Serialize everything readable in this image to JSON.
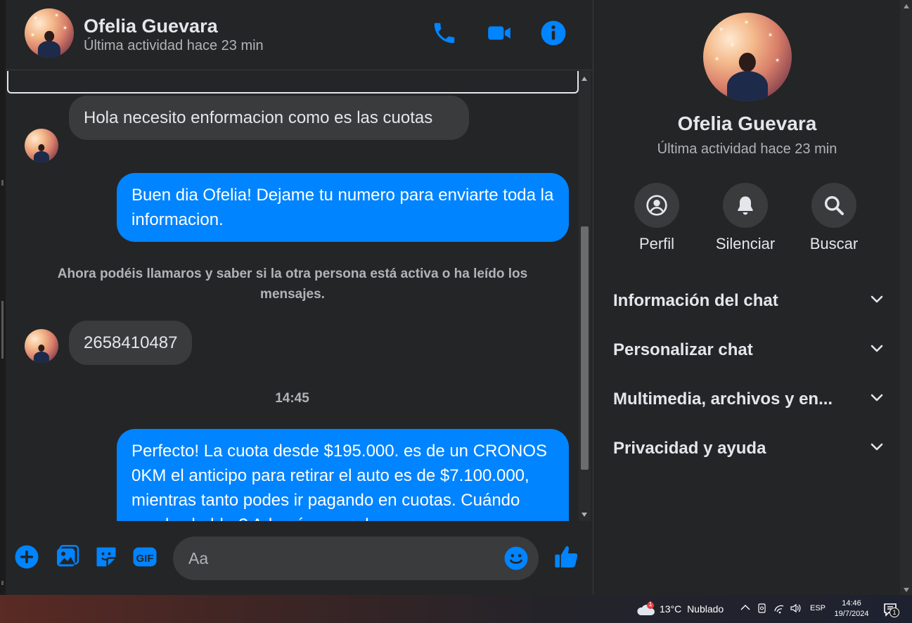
{
  "header": {
    "name": "Ofelia Guevara",
    "status": "Última actividad hace 23 min",
    "icons": [
      "phone-icon",
      "video-camera-icon",
      "info-icon"
    ]
  },
  "messages": [
    {
      "direction": "in",
      "text": "Hola necesito enformacion como es las cuotas"
    },
    {
      "direction": "out",
      "text": "Buen dia Ofelia! Dejame tu numero para enviarte toda la informacion."
    },
    {
      "type": "system",
      "text": "Ahora podéis llamaros y saber si la otra persona está activa o ha leído los mensajes."
    },
    {
      "direction": "in",
      "text": "2658410487"
    },
    {
      "type": "time",
      "text": "14:45"
    },
    {
      "direction": "out",
      "text": "Perfecto! La cuota desde $195.000. es de un CRONOS 0KM el anticipo para retirar el auto es de $7.100.000, mientras tanto podes ir pagando en cuotas. Cuándo puedes hablar? Además en cada"
    }
  ],
  "composer": {
    "placeholder": "Aa",
    "icons": [
      "plus-icon",
      "image-icon",
      "sticker-icon",
      "gif-icon",
      "emoji-icon",
      "thumbs-up-icon"
    ]
  },
  "info_panel": {
    "name": "Ofelia Guevara",
    "status": "Última actividad hace 23 min",
    "actions": [
      {
        "label": "Perfil",
        "icon": "profile-icon"
      },
      {
        "label": "Silenciar",
        "icon": "bell-icon"
      },
      {
        "label": "Buscar",
        "icon": "search-icon"
      }
    ],
    "sections": [
      "Información del chat",
      "Personalizar chat",
      "Multimedia, archivos y en...",
      "Privacidad y ayuda"
    ]
  },
  "taskbar": {
    "weather_temp": "13°C",
    "weather_desc": "Nublado",
    "weather_alert": "1",
    "language": "ESP",
    "time": "14:46",
    "date": "19/7/2024",
    "notification_count": "1"
  },
  "colors": {
    "accent": "#0084ff",
    "background": "#242526",
    "bubble_in": "#3a3b3c",
    "text_secondary": "#b0b3b8"
  }
}
